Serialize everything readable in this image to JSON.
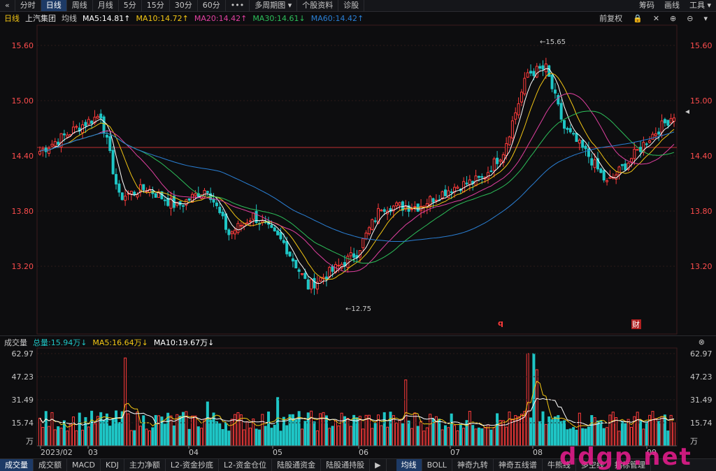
{
  "toolbar": {
    "back_icon": "«",
    "tabs": [
      "分时",
      "日线",
      "周线",
      "月线",
      "5分",
      "15分",
      "30分",
      "60分",
      "•••",
      "多周期图 ▾",
      "个股资料",
      "诊股"
    ],
    "active_tab_index": 1,
    "right": [
      "筹码",
      "画线",
      "工具 ▾"
    ]
  },
  "info": {
    "period": "日线",
    "stock_name": "上汽集团",
    "ma_label": "均线",
    "ma5": "MA5:14.81↑",
    "ma10": "MA10:14.72↑",
    "ma20": "MA20:14.42↑",
    "ma30": "MA30:14.61↓",
    "ma60": "MA60:14.42↑",
    "adjust": "前复权",
    "controls": [
      "🔒",
      "✕",
      "⊕",
      "⊖",
      "▾"
    ]
  },
  "price_axis": {
    "ticks": [
      "15.60",
      "15.00",
      "14.40",
      "13.80",
      "13.20"
    ],
    "high_marker": "15.65",
    "low_marker": "12.75"
  },
  "markers": {
    "q": "q",
    "cai": "财"
  },
  "volume": {
    "title": "成交量",
    "total": "总量:15.94万↓",
    "ma5": "MA5:16.64万↓",
    "ma10": "MA10:19.67万↓",
    "ticks": [
      "62.97",
      "47.23",
      "31.49",
      "15.74",
      "万"
    ],
    "close_icon": "⊗"
  },
  "dates": [
    "2023/02",
    "03",
    "04",
    "05",
    "06",
    "07",
    "08",
    "09"
  ],
  "bottom_tabs_left": [
    "成交量",
    "成交额",
    "MACD",
    "KDJ",
    "主力净额",
    "L2-资金抄底",
    "L2-资金仓位",
    "陆股通资金",
    "陆股通持股",
    "▶"
  ],
  "bottom_tabs_right": [
    "均线",
    "BOLL",
    "神奇九转",
    "神奇五线谱",
    "牛熊线",
    "多空线",
    "指标管理"
  ],
  "watermark": "ddgp.net",
  "colors": {
    "up": "#ff3b3b",
    "down": "#1fc6c6",
    "ma5": "#ffffff",
    "ma10": "#f2c514",
    "ma20": "#e040a0",
    "ma30": "#2dbf5a",
    "ma60": "#2a7fd4",
    "price_label": "#ff4d4d"
  }
}
